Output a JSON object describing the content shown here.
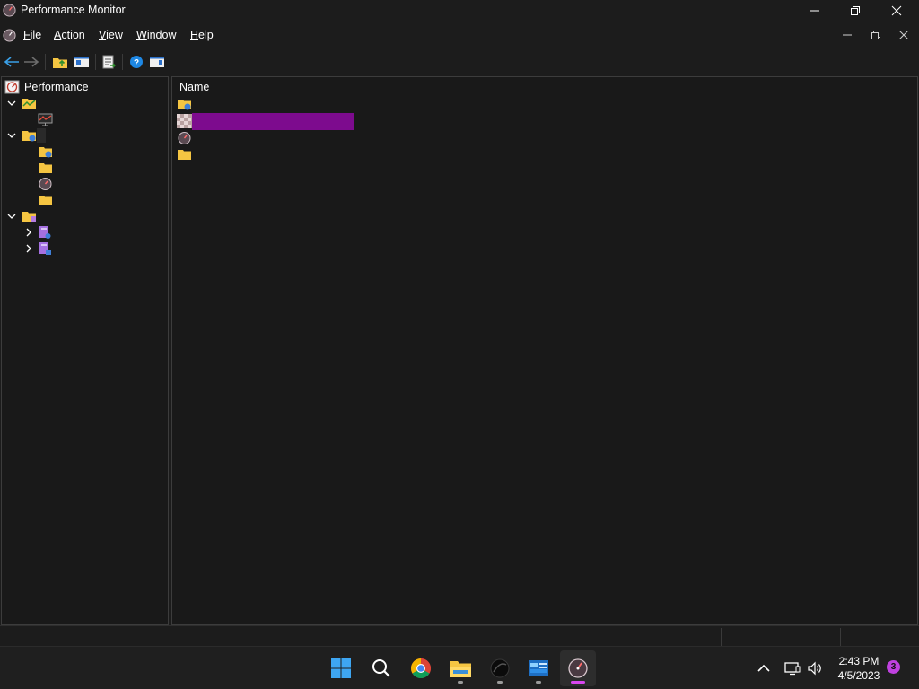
{
  "window": {
    "title": "Performance Monitor"
  },
  "menu": {
    "items": [
      {
        "u": "F",
        "rest": "ile"
      },
      {
        "u": "A",
        "rest": "ction"
      },
      {
        "u": "V",
        "rest": "iew"
      },
      {
        "u": "W",
        "rest": "indow"
      },
      {
        "u": "H",
        "rest": "elp"
      }
    ]
  },
  "tree": {
    "root_label": "Performance",
    "nodes": [
      {
        "icon": "monitoring-tools-icon",
        "expanded": true
      },
      {
        "icon": "performance-monitor-icon"
      },
      {
        "icon": "data-collector-sets-icon",
        "expanded": true
      },
      {
        "icon": "user-defined-folder-icon"
      },
      {
        "icon": "system-folder-icon"
      },
      {
        "icon": "event-trace-sessions-icon"
      },
      {
        "icon": "startup-event-trace-folder-icon"
      },
      {
        "icon": "reports-folder-icon",
        "expanded": true
      },
      {
        "icon": "user-defined-reports-icon",
        "expanded": false
      },
      {
        "icon": "system-reports-icon",
        "expanded": false
      }
    ]
  },
  "list": {
    "column_name": "Name",
    "items": [
      {
        "icon": "folder-icon"
      },
      {
        "icon": "checkered-icon",
        "highlight": "#7d0b8e"
      },
      {
        "icon": "gauge-icon"
      },
      {
        "icon": "folder-icon"
      }
    ]
  },
  "taskbar": {
    "apps": [
      "start-icon",
      "search-icon",
      "chrome-icon",
      "file-explorer-icon",
      "dark-app-icon",
      "control-panel-icon",
      "performance-monitor-icon"
    ],
    "time": "2:43 PM",
    "date": "4/5/2023",
    "notification_count": "3"
  },
  "colors": {
    "accent": "#d946ef",
    "folder": "#f5c542",
    "redaction": "#7d0b8e"
  }
}
